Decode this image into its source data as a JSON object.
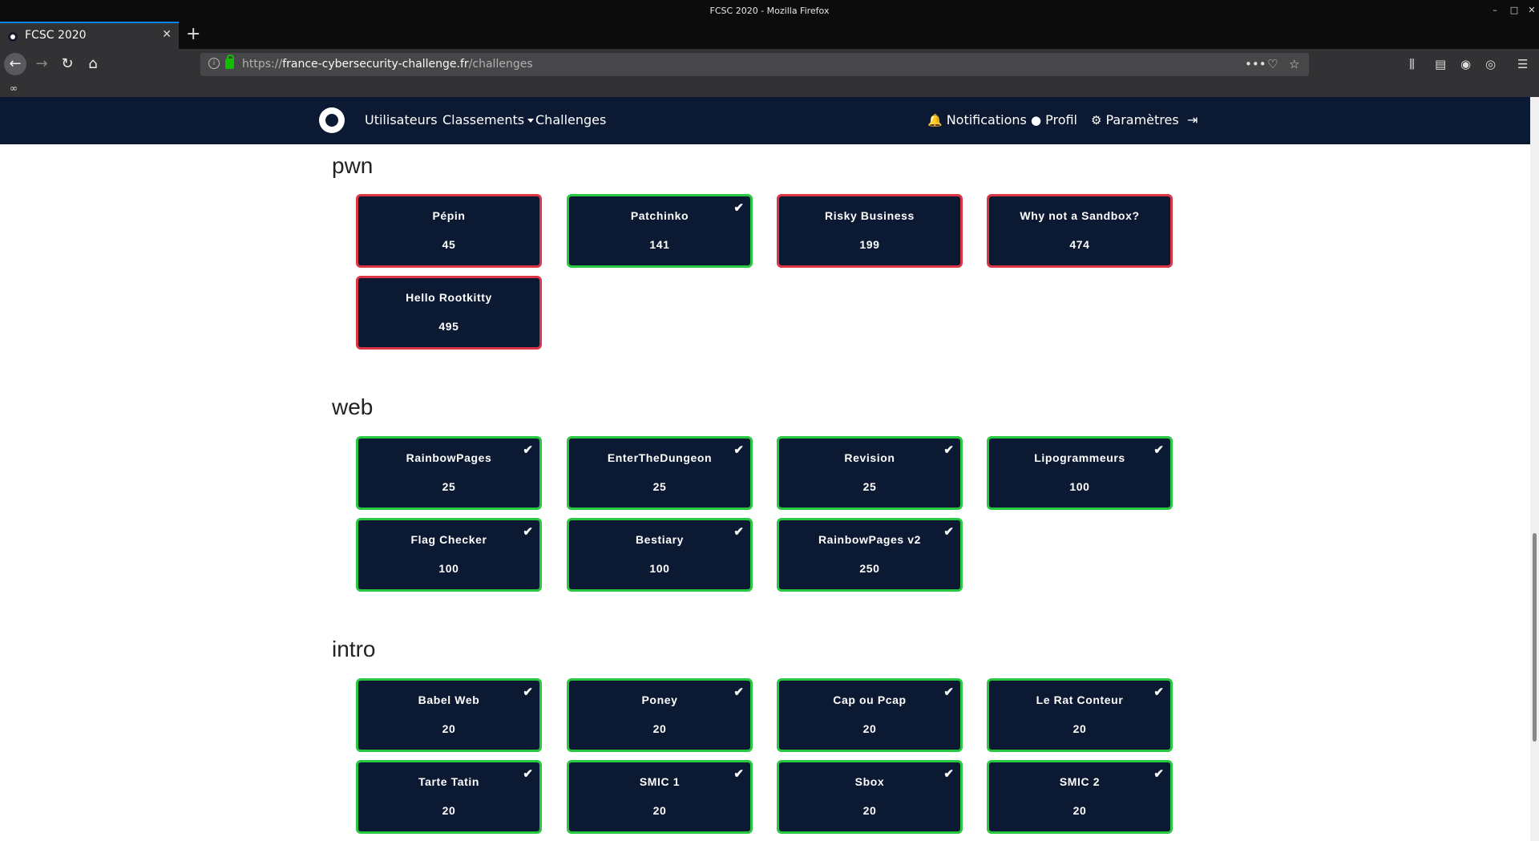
{
  "browser": {
    "window_title": "FCSC 2020 - Mozilla Firefox",
    "tab_title": "FCSC 2020",
    "url_scheme": "https://",
    "url_host": "france-cybersecurity-challenge.fr",
    "url_path": "/challenges"
  },
  "site_nav": {
    "users": "Utilisateurs",
    "rankings": "Classements",
    "challenges": "Challenges",
    "notifications": "Notifications",
    "profile": "Profil",
    "settings": "Paramètres"
  },
  "categories": [
    {
      "name": "pwn",
      "challenges": [
        {
          "name": "Pépin",
          "points": "45",
          "solved": false
        },
        {
          "name": "Patchinko",
          "points": "141",
          "solved": true
        },
        {
          "name": "Risky Business",
          "points": "199",
          "solved": false
        },
        {
          "name": "Why not a Sandbox?",
          "points": "474",
          "solved": false
        },
        {
          "name": "Hello Rootkitty",
          "points": "495",
          "solved": false
        }
      ]
    },
    {
      "name": "web",
      "challenges": [
        {
          "name": "RainbowPages",
          "points": "25",
          "solved": true
        },
        {
          "name": "EnterTheDungeon",
          "points": "25",
          "solved": true
        },
        {
          "name": "Revision",
          "points": "25",
          "solved": true
        },
        {
          "name": "Lipogrammeurs",
          "points": "100",
          "solved": true
        },
        {
          "name": "Flag Checker",
          "points": "100",
          "solved": true
        },
        {
          "name": "Bestiary",
          "points": "100",
          "solved": true
        },
        {
          "name": "RainbowPages v2",
          "points": "250",
          "solved": true
        }
      ]
    },
    {
      "name": "intro",
      "challenges": [
        {
          "name": "Babel Web",
          "points": "20",
          "solved": true
        },
        {
          "name": "Poney",
          "points": "20",
          "solved": true
        },
        {
          "name": "Cap ou Pcap",
          "points": "20",
          "solved": true
        },
        {
          "name": "Le Rat Conteur",
          "points": "20",
          "solved": true
        },
        {
          "name": "Tarte Tatin",
          "points": "20",
          "solved": true
        },
        {
          "name": "SMIC 1",
          "points": "20",
          "solved": true
        },
        {
          "name": "Sbox",
          "points": "20",
          "solved": true
        },
        {
          "name": "SMIC 2",
          "points": "20",
          "solved": true
        }
      ]
    }
  ],
  "colors": {
    "solved_border": "#28c840",
    "unsolved_border": "#dc3545",
    "card_bg": "#0b1932"
  }
}
